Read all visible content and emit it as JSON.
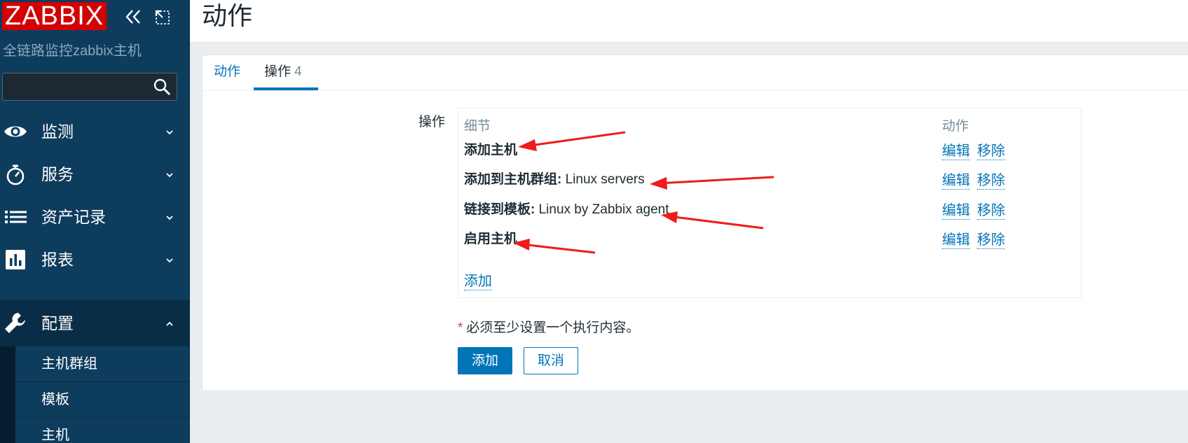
{
  "sidebar": {
    "logo": "ZABBIX",
    "server_name": "全链路监控zabbix主机",
    "search": {
      "value": "",
      "placeholder": ""
    },
    "nav": [
      {
        "label": "监测",
        "icon": "eye-icon"
      },
      {
        "label": "服务",
        "icon": "stopwatch-icon"
      },
      {
        "label": "资产记录",
        "icon": "list-icon"
      },
      {
        "label": "报表",
        "icon": "bar-chart-icon"
      },
      {
        "label": "配置",
        "icon": "wrench-icon",
        "expanded": true
      }
    ],
    "submenu": [
      {
        "label": "主机群组"
      },
      {
        "label": "模板"
      },
      {
        "label": "主机"
      }
    ]
  },
  "header": {
    "title": "动作"
  },
  "tabs": [
    {
      "label": "动作"
    },
    {
      "label": "操作",
      "count": "4",
      "active": true
    }
  ],
  "form": {
    "label": "操作",
    "columns": {
      "details": "细节",
      "action": "动作"
    },
    "rows": [
      {
        "name": "添加主机",
        "value": ""
      },
      {
        "name": "添加到主机群组:",
        "value": " Linux servers"
      },
      {
        "name": "链接到模板:",
        "value": " Linux by Zabbix agent"
      },
      {
        "name": "启用主机",
        "value": ""
      }
    ],
    "edit_label": "编辑",
    "remove_label": "移除",
    "add_link": "添加",
    "required_star": "*",
    "required_note": "必须至少设置一个执行内容。",
    "buttons": {
      "add": "添加",
      "cancel": "取消"
    }
  },
  "colors": {
    "sidebar_bg": "#0e3c5d",
    "logo_bg": "#d40000",
    "link": "#0275b8",
    "annotation_arrow": "#ee1c1c"
  }
}
